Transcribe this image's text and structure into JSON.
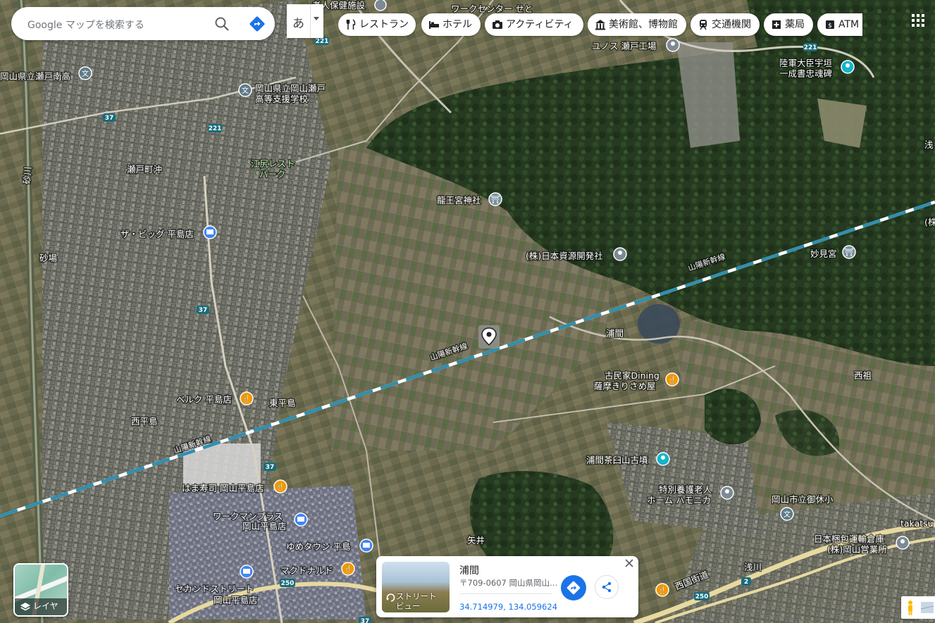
{
  "search": {
    "placeholder": "Google マップを検索する",
    "ime_char": "あ"
  },
  "chips": [
    {
      "label": "レストラン",
      "icon": "fork-knife-icon"
    },
    {
      "label": "ホテル",
      "icon": "bed-icon"
    },
    {
      "label": "アクティビティ",
      "icon": "camera-icon"
    },
    {
      "label": "美術館、博物館",
      "icon": "museum-icon"
    },
    {
      "label": "交通機関",
      "icon": "train-icon"
    },
    {
      "label": "薬局",
      "icon": "pharmacy-icon"
    },
    {
      "label": "ATM",
      "icon": "atm-icon"
    }
  ],
  "layer": {
    "label": "レイヤ"
  },
  "card": {
    "title": "浦間",
    "address": "〒709-0607 岡山県岡山…",
    "coordinates": "34.714979, 134.059624",
    "streetview_label": "ストリート\nビュー"
  },
  "map": {
    "places": {
      "setominami": "岡山県立瀬戸南高",
      "shienschool_1": "岡山県立岡山瀬戸",
      "shienschool_2": "高等支援学校",
      "edorest_1": "江尻レスト",
      "edorest_2": "パーク",
      "setochooki": "瀬戸町沖",
      "thebig": "ザ・ビッグ 平島店",
      "sunaba": "砂場",
      "ryuogu": "龍王宮神社",
      "nihonshigen": "(株)日本資源開発社",
      "myokengu": "妙見宮",
      "urama": "浦間",
      "kominka_1": "古民家Dining",
      "kominka_2": "薩摩きりさめ屋",
      "nishiso": "西祖",
      "berg": "ベルク 平島店",
      "higashihirashima": "東平島",
      "nishihirashima": "西平島",
      "hamazushi": "はま寿司 岡山平島店",
      "workman_1": "ワークマンプラス",
      "workman_2": "岡山平島店",
      "youme": "ゆめタウン 平島",
      "mcdonalds": "マクドナルド",
      "second_1": "セカンドストリート",
      "second_2": "岡山平島店",
      "chausuyama": "浦間茶臼山古墳",
      "roujin_1": "特別養護老人",
      "roujin_2": "ホーム ハモニカ",
      "gokyuu": "岡山市立御休小",
      "konpou_1": "日本梱包運輸倉庫",
      "konpou_2": "(株)岡山営業所",
      "takatsu": "takatsu",
      "asakawa": "浅川",
      "yai": "矢井",
      "saigoku": "西国街道",
      "yunosu": "ユノス 瀬戸工場",
      "rikugun_1": "陸軍大臣宇垣",
      "rikugun_2": "一成書忠魂碑",
      "workcenter": "ワークセンター せと",
      "rojin_top": "老人保健施設",
      "asa_right": "浅",
      "kabu_right": "(株",
      "sunagawa": "砂川",
      "shinkansen": "山陽新幹線"
    },
    "route_numbers": [
      "221",
      "221",
      "221",
      "37",
      "37",
      "37",
      "250",
      "250",
      "2",
      "37"
    ]
  },
  "colors": {
    "accent": "#1a73e8",
    "rail": "#3aa0c8",
    "restaurant": "#f29900",
    "shop": "#4285f4",
    "teal": "#12b5cb"
  }
}
